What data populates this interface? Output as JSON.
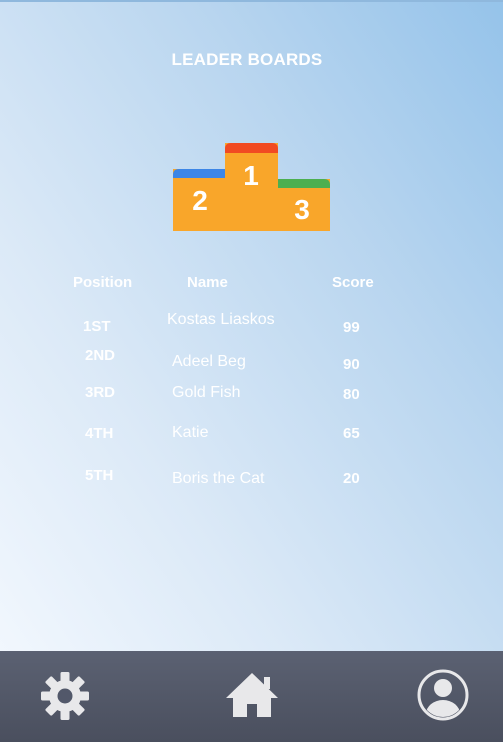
{
  "header": {
    "title": "LEADER BOARDS"
  },
  "podium": {
    "first": "1",
    "second": "2",
    "third": "3"
  },
  "table": {
    "headers": {
      "position": "Position",
      "name": "Name",
      "score": "Score"
    },
    "rows": [
      {
        "position": "1ST",
        "name": "Kostas Liaskos",
        "score": "99"
      },
      {
        "position": "2ND",
        "name": "Adeel Beg",
        "score": "90"
      },
      {
        "position": "3RD",
        "name": "Gold Fish",
        "score": "80"
      },
      {
        "position": "4TH",
        "name": "Katie",
        "score": "65"
      },
      {
        "position": "5TH",
        "name": "Boris the Cat",
        "score": "20"
      }
    ]
  },
  "nav": {
    "items": [
      {
        "icon": "gear-icon"
      },
      {
        "icon": "home-icon"
      },
      {
        "icon": "user-profile-icon"
      }
    ]
  },
  "colors": {
    "podium_base": "#f9a62a",
    "first_top": "#f14a22",
    "second_top": "#3d86e6",
    "third_top": "#4caf50",
    "nav_bar": "#52586a",
    "icon": "#e8e8ea"
  }
}
